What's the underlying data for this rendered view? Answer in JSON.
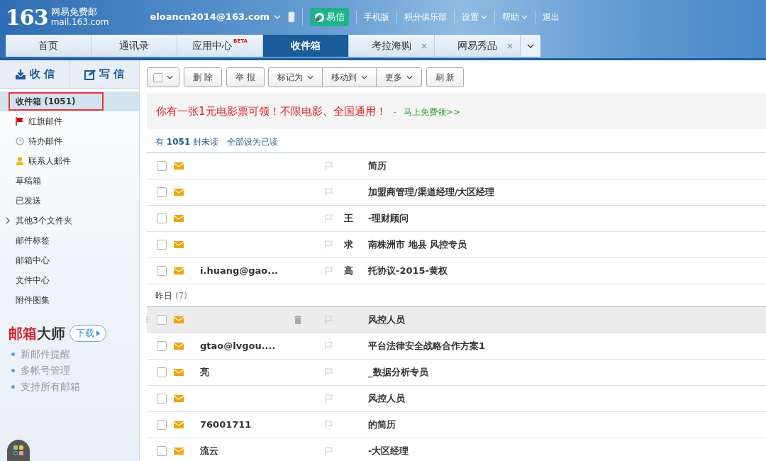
{
  "logo": {
    "number": "163",
    "name": "网易免费邮",
    "domain": "mail.163.com"
  },
  "account": {
    "email": "eloancn2014@163.com"
  },
  "top_links": [
    {
      "kind": "app",
      "label": "易信"
    },
    {
      "kind": "link",
      "label": "手机版"
    },
    {
      "kind": "link",
      "label": "积分俱乐部"
    },
    {
      "kind": "menu",
      "label": "设置"
    },
    {
      "kind": "menu",
      "label": "帮助"
    },
    {
      "kind": "link",
      "label": "退出"
    }
  ],
  "tabs": [
    {
      "label": "首页",
      "selected": false,
      "closable": false
    },
    {
      "label": "通讯录",
      "selected": false,
      "closable": false
    },
    {
      "label": "应用中心",
      "badge": "BETA",
      "selected": false,
      "closable": false
    },
    {
      "label": "收件箱",
      "selected": true,
      "closable": false
    },
    {
      "label": "考拉海购",
      "selected": false,
      "closable": true
    },
    {
      "label": "网易秀品",
      "selected": false,
      "closable": true
    }
  ],
  "sidebar": {
    "receive": "收 信",
    "compose": "写 信",
    "items": [
      {
        "label": "收件箱 (1051)",
        "kind": "plain",
        "selected": true
      },
      {
        "label": "红旗邮件",
        "kind": "flag",
        "selected": false
      },
      {
        "label": "待办邮件",
        "kind": "clock",
        "selected": false
      },
      {
        "label": "联系人邮件",
        "kind": "person",
        "selected": false
      },
      {
        "label": "草稿箱",
        "kind": "plain",
        "selected": false
      },
      {
        "label": "已发送",
        "kind": "plain",
        "selected": false
      },
      {
        "label": "其他3个文件夹",
        "kind": "collapsed",
        "selected": false
      },
      {
        "label": "邮件标签",
        "kind": "plain",
        "selected": false
      },
      {
        "label": "邮箱中心",
        "kind": "plain",
        "selected": false
      },
      {
        "label": "文件中心",
        "kind": "plain",
        "selected": false
      },
      {
        "label": "附件图集",
        "kind": "plain",
        "selected": false
      }
    ],
    "promo": {
      "title_red": "邮箱",
      "title_dark": "大师",
      "download": "下载",
      "features": [
        "新邮件提醒",
        "多帐号管理",
        "支持所有邮箱"
      ]
    }
  },
  "toolbar": [
    {
      "kind": "check"
    },
    {
      "kind": "button",
      "label": "删 除"
    },
    {
      "kind": "button",
      "label": "举 报"
    },
    {
      "kind": "dropdown",
      "label": "标记为"
    },
    {
      "kind": "dropdown",
      "label": "移动到"
    },
    {
      "kind": "dropdown",
      "label": "更多"
    },
    {
      "kind": "button",
      "label": "刷 新"
    }
  ],
  "banner": {
    "text": "你有一张1元电影票可领！不限电影、全国通用！",
    "sep": "-",
    "link": "马上免费领>>"
  },
  "unread": {
    "text": "有 **1051** 封未读",
    "mark_all": "全部设为已读"
  },
  "groups": [
    {
      "rows": [
        {
          "subject": "简历",
          "unread": true,
          "hovered": false,
          "checked": false
        },
        {
          "subject": "加盟商管理/渠道经理/大区经理",
          "unread": true,
          "hovered": false,
          "checked": false
        },
        {
          "subject_head": "王",
          "subject": "-理财顾问",
          "unread": true,
          "hovered": false,
          "checked": false
        },
        {
          "subject_head": "求",
          "subject": "南株洲市 地县 风控专员",
          "unread": true,
          "hovered": false,
          "checked": false
        },
        {
          "sender": "i.huang@gao...",
          "subject_head": "高",
          "subject": "托协议-2015-黄权",
          "unread": true,
          "hovered": false,
          "checked": false
        }
      ]
    },
    {
      "label": "昨日",
      "count": "(7)",
      "rows": [
        {
          "subject": "风控人员",
          "unread": true,
          "hovered": true,
          "checked": false
        },
        {
          "sender": "gtao@lvgou....",
          "subject": "平台法律安全战略合作方案1",
          "unread": true,
          "hovered": false,
          "checked": false
        },
        {
          "sender": "亮",
          "subject": "_数据分析专员",
          "unread": true,
          "hovered": false,
          "checked": false
        },
        {
          "subject": "风控人员",
          "unread": true,
          "hovered": false,
          "checked": false
        },
        {
          "sender": "76001711",
          "subject": "的简历",
          "unread": true,
          "hovered": false,
          "checked": false
        },
        {
          "sender": "流云",
          "subject": "-大区经理",
          "unread": true,
          "hovered": false,
          "checked": false
        }
      ]
    }
  ]
}
